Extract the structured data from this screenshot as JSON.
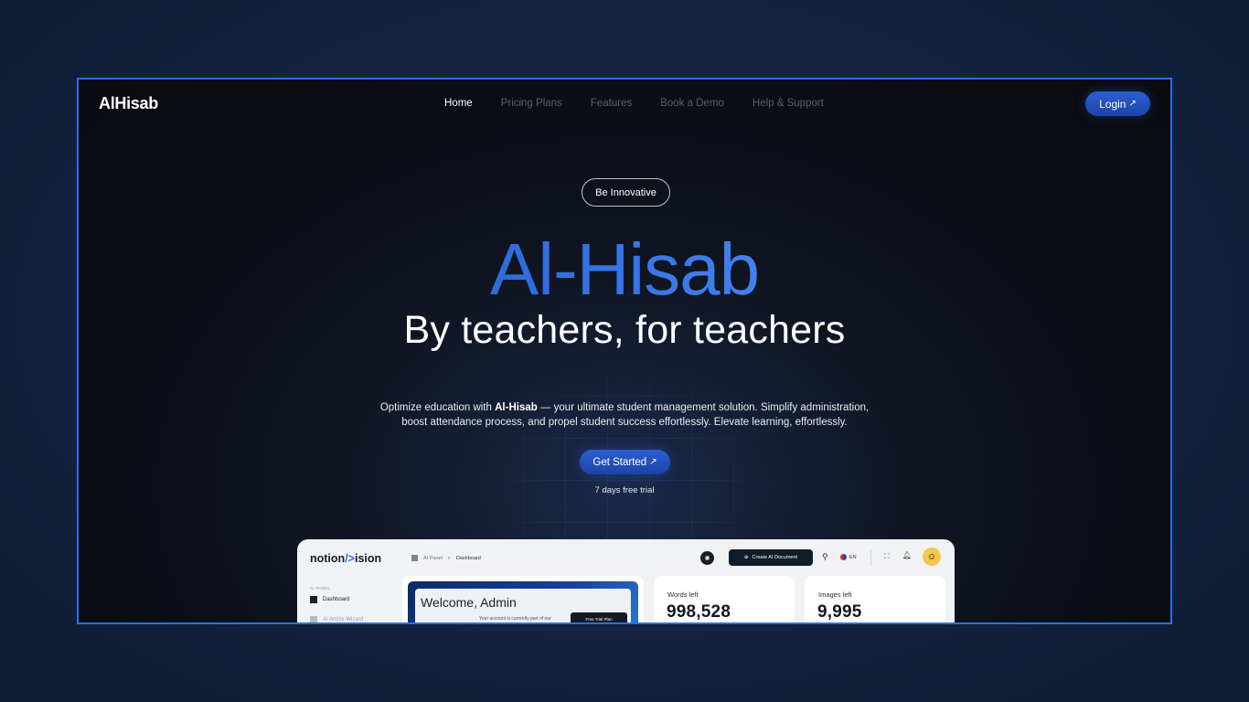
{
  "colors": {
    "accent": "#2a6ff0",
    "button": "#2d5fd0",
    "page_bg": "#142440",
    "frame_bg": "#0b0d14"
  },
  "header": {
    "logo": "AlHisab",
    "nav": [
      {
        "label": "Home",
        "active": true
      },
      {
        "label": "Pricing Plans",
        "active": false
      },
      {
        "label": "Features",
        "active": false
      },
      {
        "label": "Book a Demo",
        "active": false
      },
      {
        "label": "Help & Support",
        "active": false
      }
    ],
    "login_label": "Login",
    "arrow_icon": "arrow-up-right-icon"
  },
  "hero": {
    "badge": "Be Innovative",
    "brand": "Al-Hisab",
    "tagline": "By teachers, for teachers",
    "desc_pre": "Optimize education with ",
    "desc_bold": "Al-Hisab",
    "desc_post": " — your ultimate student management solution. Simplify administration,",
    "desc_line2": "boost attendance process, and propel student success effortlessly. Elevate learning, effortlessly.",
    "cta_label": "Get Started",
    "trial_note": "7 days free trial"
  },
  "dashboard": {
    "logo_start": "notion",
    "logo_accent": "/>",
    "logo_end": "ision",
    "breadcrumb": [
      "AI Panel",
      "Dashboard"
    ],
    "create_label": "Create AI Document",
    "lang": "EN",
    "sidebar_section": "AI PANEL",
    "sidebar_items": [
      "Dashboard",
      "AI Article Wizard"
    ],
    "welcome_title": "Welcome, Admin",
    "welcome_note": "Your account is currently part of our",
    "free_plan": "Free Trial Plan",
    "stats": [
      {
        "label": "Words left",
        "value": "998,528"
      },
      {
        "label": "Images left",
        "value": "9,995"
      }
    ]
  }
}
